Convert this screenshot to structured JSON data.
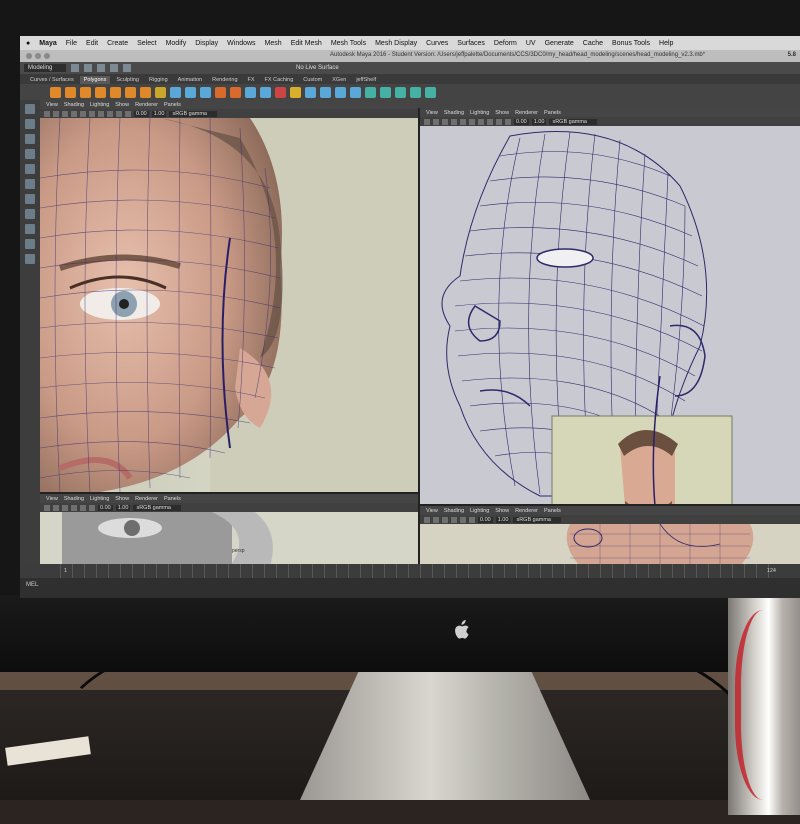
{
  "menubar": {
    "apple": "",
    "app": "Maya",
    "items": [
      "File",
      "Edit",
      "Create",
      "Select",
      "Modify",
      "Display",
      "Windows",
      "Mesh",
      "Edit Mesh",
      "Mesh Tools",
      "Mesh Display",
      "Curves",
      "Surfaces",
      "Deform",
      "UV",
      "Generate",
      "Cache",
      "Bonus Tools",
      "Help"
    ]
  },
  "window": {
    "title": "Autodesk Maya 2016 - Student Version: /Users/jeffpalette/Documents/CCS/3DC0/my_head/head_modeling/scenes/head_modeling_v2.3.mb*",
    "version_badge": "5.8"
  },
  "statusline": {
    "mode": "Modeling",
    "live_surface": "No Live Surface"
  },
  "shelf": {
    "tabs": [
      "Curves / Surfaces",
      "Polygons",
      "Sculpting",
      "Rigging",
      "Animation",
      "Rendering",
      "FX",
      "FX Caching",
      "Custom",
      "XGen",
      "jeffShelf"
    ],
    "active_tab": "Polygons",
    "icon_colors": [
      "#e0892b",
      "#e0892b",
      "#e0892b",
      "#e0892b",
      "#e0892b",
      "#e0892b",
      "#e0892b",
      "#c9a62c",
      "#59a8d8",
      "#59a8d8",
      "#59a8d8",
      "#d86a2b",
      "#d86a2b",
      "#59a8d8",
      "#59a8d8",
      "#c44",
      "#d8b02b",
      "#59a8d8",
      "#59a8d8",
      "#59a8d8",
      "#59a8d8",
      "#45b0a4",
      "#45b0a4",
      "#45b0a4",
      "#45b0a4",
      "#45b0a4"
    ]
  },
  "panels": [
    {
      "menu": [
        "View",
        "Shading",
        "Lighting",
        "Show",
        "Renderer",
        "Panels"
      ],
      "value_a": "0.00",
      "value_b": "1.00",
      "gamma": "sRGB gamma"
    },
    {
      "menu": [
        "View",
        "Shading",
        "Lighting",
        "Show",
        "Renderer",
        "Panels"
      ],
      "value_a": "0.00",
      "value_b": "1.00",
      "gamma": "sRGB gamma"
    },
    {
      "menu": [
        "View",
        "Shading",
        "Lighting",
        "Show",
        "Renderer",
        "Panels"
      ],
      "value_a": "0.00",
      "value_b": "1.00",
      "gamma": "sRGB gamma",
      "caption": "persp"
    },
    {
      "menu": [
        "View",
        "Shading",
        "Lighting",
        "Show",
        "Renderer",
        "Panels"
      ],
      "value_a": "0.00",
      "value_b": "1.00",
      "gamma": "sRGB gamma"
    }
  ],
  "timeline": {
    "start": "1",
    "end": "124"
  },
  "cmdline": {
    "label": "MEL"
  }
}
